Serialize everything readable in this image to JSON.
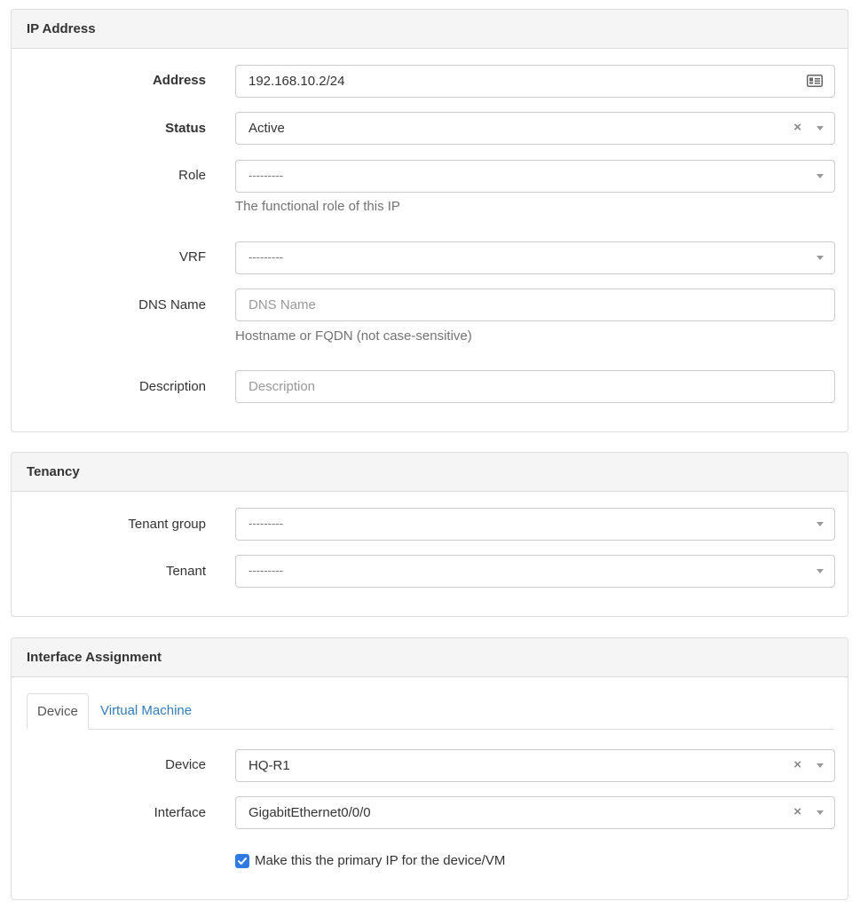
{
  "ip_panel": {
    "title": "IP Address",
    "address": {
      "label": "Address",
      "value": "192.168.10.2/24",
      "icon": "id-card-icon"
    },
    "status": {
      "label": "Status",
      "value": "Active",
      "clear": "×"
    },
    "role": {
      "label": "Role",
      "value": "---------",
      "help": "The functional role of this IP"
    },
    "vrf": {
      "label": "VRF",
      "value": "---------"
    },
    "dns_name": {
      "label": "DNS Name",
      "placeholder": "DNS Name",
      "help": "Hostname or FQDN (not case-sensitive)"
    },
    "description": {
      "label": "Description",
      "placeholder": "Description"
    }
  },
  "tenancy_panel": {
    "title": "Tenancy",
    "tenant_group": {
      "label": "Tenant group",
      "value": "---------"
    },
    "tenant": {
      "label": "Tenant",
      "value": "---------"
    }
  },
  "interface_panel": {
    "title": "Interface Assignment",
    "tabs": [
      {
        "label": "Device",
        "active": true
      },
      {
        "label": "Virtual Machine",
        "active": false
      }
    ],
    "device": {
      "label": "Device",
      "value": "HQ-R1",
      "clear": "×"
    },
    "interface": {
      "label": "Interface",
      "value": "GigabitEthernet0/0/0",
      "clear": "×"
    },
    "primary_ip": {
      "label": "Make this the primary IP for the device/VM",
      "checked": true
    }
  },
  "colors": {
    "accent": "#2f7ae5",
    "link": "#337ab7",
    "heading_bg": "#f5f5f5"
  }
}
